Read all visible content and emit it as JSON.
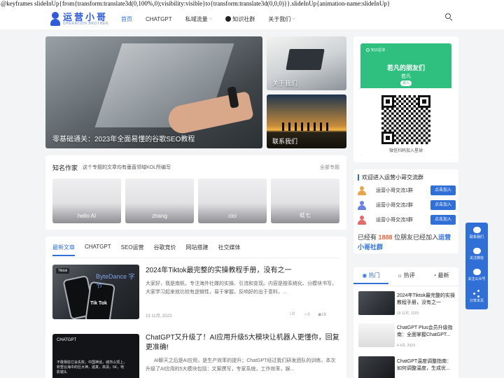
{
  "page_leak_text": "@keyframes slideInUp{from{transform:translate3d(0,100%,0);visibility:visible}to{transform:translate3d(0,0,0)}}.slideInUp{animation-name:slideInUp}",
  "header": {
    "logo_cn": "运营小哥",
    "logo_en": "OPERATION BROTHER",
    "nav": [
      {
        "label": "首页",
        "active": true
      },
      {
        "label": "CHATGPT"
      },
      {
        "label": "私域流量"
      },
      {
        "label": "知识社群"
      },
      {
        "label": "关于我们"
      }
    ]
  },
  "hero": {
    "main_caption": "零基础通关：2023年全面易懂的谷歌SEO教程",
    "side1_caption": "关于我们",
    "side2_caption": "联系我们"
  },
  "qr_card": {
    "top_label": "知识星球",
    "name": "若凡的朋友们",
    "sub": "若凡",
    "pill": "进入",
    "caption": "微信扫码加入星球"
  },
  "authors": {
    "title": "知名作家",
    "desc": "这个专题的文章均有垂直领域KOL所编写",
    "all": "全部专题",
    "items": [
      "hello AI",
      "zhang",
      "cici",
      "虹七"
    ]
  },
  "join_group": {
    "title": "欢迎进入运营小哥交流群",
    "groups": [
      {
        "label": "运营小哥交流1群",
        "button": "点击加入"
      },
      {
        "label": "运营小哥交流2群",
        "button": "点击加入"
      },
      {
        "label": "运营小哥交流3群",
        "button": "点击加入"
      }
    ],
    "count_prefix": "已经有",
    "count": "1888",
    "count_mid": "位朋友已经加入",
    "count_link": "运营小哥社群"
  },
  "article_tabs": [
    "最新文章",
    "CHATGPT",
    "SEO运营",
    "谷歌竞价",
    "网站搭建",
    "社交媒体"
  ],
  "articles": [
    {
      "tag": "Tiktok",
      "thumb_text": "Tik Tok",
      "thumb_brand": "ByteDance 字节",
      "title": "2024年Tiktok最完整的实操教程手册，没有之一",
      "excerpt": "大家好，我是南帆，专注海外社媒的实操、引流和变现。内容是按系统化、分模块书写，大家学习起来就比较有逻辑性，易于掌握。反响好的出于意料，...",
      "date": "19 11月, 2023",
      "comments": "0",
      "likes": "0",
      "views": "19"
    },
    {
      "tag": "CHATGPT",
      "thumb_text": "不敢相信它会失败，中国神话，城市山顶上，积雪云海中的巨大神，逼真，高清，5K，电影镜头",
      "title": "ChatGPT又升级了！AI应用升级5大模块让机器人更懂你，回复更准确!",
      "excerpt": "AI聊天之后是AI应用，是生产效率的提升；ChatGPT经过我们研发团队的训练，本次升级了AI应用的5大模块包括：文案撰写，专家系统，工作效率，娱..."
    }
  ],
  "popular": {
    "tabs": [
      "热门",
      "热评",
      "最新"
    ],
    "items": [
      {
        "title": "2024年Tiktok最完整的实操教程手册，没有之一",
        "date": "19 11月, 2023"
      },
      {
        "title": "ChatGPT Plus会员升级指南：全面掌握ChatGPT...",
        "date": "4 4月, 2023"
      },
      {
        "title": "ChatGPT温度调整指南：如何调整温度，生成优..."
      }
    ]
  },
  "float_bar": [
    "联系我们",
    "关注微信",
    "关注公众号",
    "分享本页"
  ]
}
